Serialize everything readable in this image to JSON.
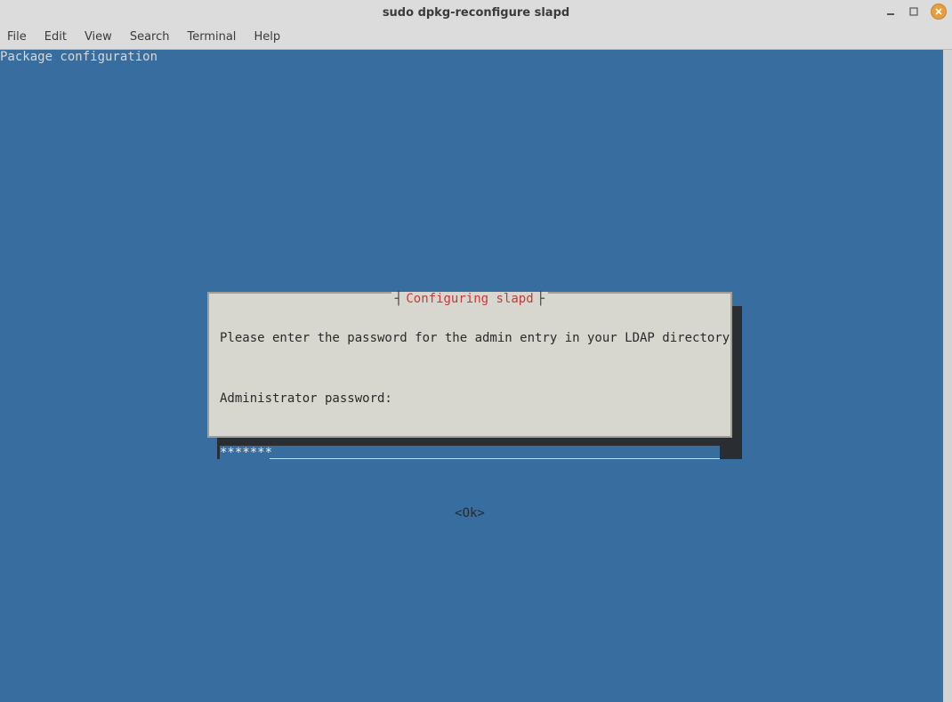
{
  "window": {
    "title": "sudo dpkg-reconfigure slapd"
  },
  "menubar": {
    "items": [
      "File",
      "Edit",
      "View",
      "Search",
      "Terminal",
      "Help"
    ]
  },
  "terminal": {
    "header": "Package configuration"
  },
  "dialog": {
    "title": "Configuring slapd",
    "prompt": "Please enter the password for the admin entry in your LDAP directory.",
    "label": "Administrator password:",
    "password_value": "*******",
    "ok_label": "<Ok>"
  }
}
